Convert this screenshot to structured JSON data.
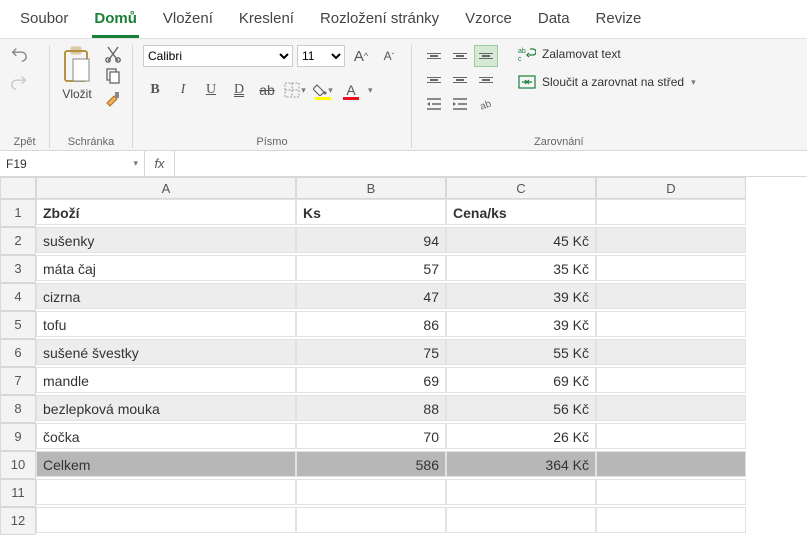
{
  "tabs": [
    "Soubor",
    "Domů",
    "Vložení",
    "Kreslení",
    "Rozložení stránky",
    "Vzorce",
    "Data",
    "Revize"
  ],
  "active_tab": 1,
  "qat_label": "Zpět",
  "clipboard": {
    "paste": "Vložit",
    "label": "Schránka"
  },
  "font": {
    "name": "Calibri",
    "size": "11",
    "label": "Písmo",
    "btn_bold": "B",
    "btn_italic": "I",
    "btn_under": "U",
    "btn_dbl": "D",
    "btn_strike": "ab",
    "btn_inc": "A",
    "btn_dec": "A",
    "btn_fill_glyph": "⬚",
    "btn_fontc": "A"
  },
  "alignment": {
    "label": "Zarovnání",
    "wrap": "Zalamovat text",
    "merge": "Sloučit a zarovnat na střed"
  },
  "namebox": "F19",
  "formula": "",
  "fx_label": "fx",
  "columns": [
    "A",
    "B",
    "C",
    "D"
  ],
  "rows": [
    {
      "n": 1,
      "cls": "r-header",
      "a": "Zboží",
      "b": "Ks",
      "c": "Cena/ks",
      "d": ""
    },
    {
      "n": 2,
      "cls": "band",
      "a": "sušenky",
      "b": "94",
      "c": "45 Kč",
      "d": ""
    },
    {
      "n": 3,
      "cls": "",
      "a": "máta čaj",
      "b": "57",
      "c": "35 Kč",
      "d": ""
    },
    {
      "n": 4,
      "cls": "band",
      "a": "cizrna",
      "b": "47",
      "c": "39 Kč",
      "d": ""
    },
    {
      "n": 5,
      "cls": "",
      "a": "tofu",
      "b": "86",
      "c": "39 Kč",
      "d": ""
    },
    {
      "n": 6,
      "cls": "band",
      "a": "sušené švestky",
      "b": "75",
      "c": "55 Kč",
      "d": ""
    },
    {
      "n": 7,
      "cls": "",
      "a": "mandle",
      "b": "69",
      "c": "69 Kč",
      "d": ""
    },
    {
      "n": 8,
      "cls": "band",
      "a": "bezlepková mouka",
      "b": "88",
      "c": "56 Kč",
      "d": ""
    },
    {
      "n": 9,
      "cls": "",
      "a": "čočka",
      "b": "70",
      "c": "26 Kč",
      "d": ""
    },
    {
      "n": 10,
      "cls": "total",
      "a": "Celkem",
      "b": "586",
      "c": "364 Kč",
      "d": ""
    },
    {
      "n": 11,
      "cls": "",
      "a": "",
      "b": "",
      "c": "",
      "d": ""
    },
    {
      "n": 12,
      "cls": "",
      "a": "",
      "b": "",
      "c": "",
      "d": ""
    }
  ]
}
